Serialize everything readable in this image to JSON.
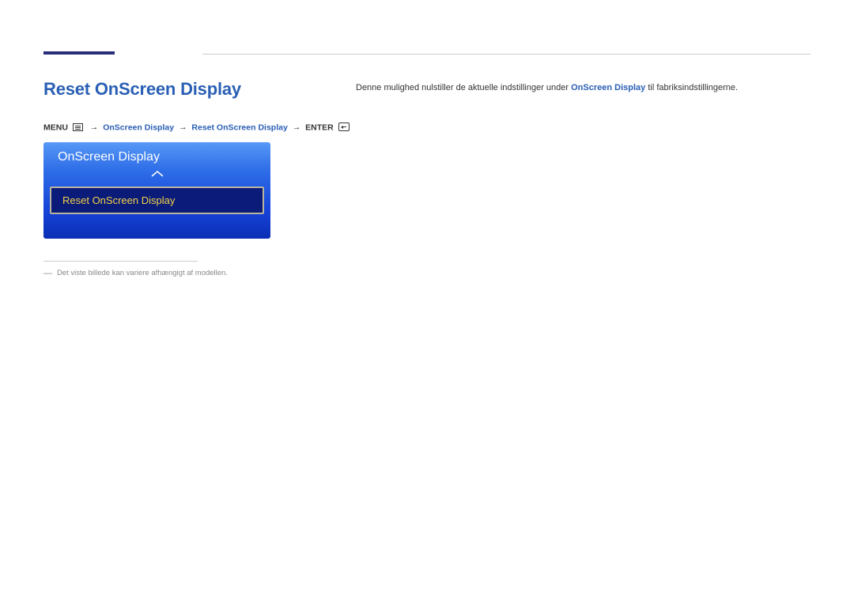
{
  "heading": "Reset OnScreen Display",
  "breadcrumb": {
    "menu_label": "MENU",
    "step1": "OnScreen Display",
    "step2": "Reset OnScreen Display",
    "enter_label": "ENTER",
    "arrow": "→"
  },
  "osd_panel": {
    "title": "OnScreen Display",
    "selected_item": "Reset OnScreen Display"
  },
  "footnote": {
    "dash": "―",
    "text": "Det viste billede kan variere afhængigt af modellen."
  },
  "description": {
    "prefix": "Denne mulighed nulstiller de aktuelle indstillinger under ",
    "highlight": "OnScreen Display",
    "suffix": " til fabriksindstillingerne."
  }
}
